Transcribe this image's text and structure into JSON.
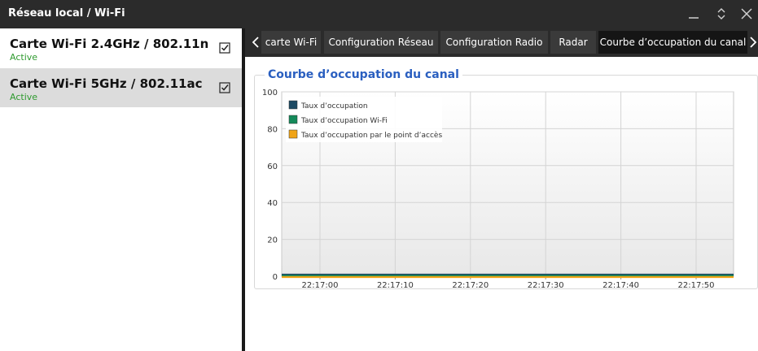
{
  "window": {
    "title": "Réseau local / Wi-Fi"
  },
  "sidebar": {
    "items": [
      {
        "name": "Carte Wi-Fi 2.4GHz / 802.11n",
        "status": "Active",
        "checked": true,
        "selected": false
      },
      {
        "name": "Carte Wi-Fi 5GHz / 802.11ac",
        "status": "Active",
        "checked": true,
        "selected": true
      }
    ]
  },
  "tabs": [
    {
      "label": "carte Wi-Fi"
    },
    {
      "label": "Configuration Réseau"
    },
    {
      "label": "Configuration Radio"
    },
    {
      "label": "Radar"
    },
    {
      "label": "Courbe d’occupation du canal",
      "active": true
    }
  ],
  "panel": {
    "title": "Courbe d’occupation du canal"
  },
  "colors": {
    "titlebar": "#2b2b2b",
    "accent_title": "#2a5fc0",
    "status_active": "#2e9a2e",
    "series_occupation": "#1d4a63",
    "series_wifi": "#148a5a",
    "series_ap": "#f0a417"
  },
  "chart_data": {
    "type": "line",
    "x": [
      "22:17:00",
      "22:17:10",
      "22:17:20",
      "22:17:30",
      "22:17:40",
      "22:17:50"
    ],
    "ylim": [
      0,
      100
    ],
    "yticks": [
      0,
      20,
      40,
      60,
      80,
      100
    ],
    "grid": true,
    "legend": "top-left",
    "series": [
      {
        "name": "Taux d’occupation",
        "values": [
          0,
          0,
          0,
          0,
          0,
          0
        ],
        "color": "#1d4a63"
      },
      {
        "name": "Taux d’occupation Wi-Fi",
        "values": [
          0,
          0,
          0,
          0,
          0,
          0
        ],
        "color": "#148a5a"
      },
      {
        "name": "Taux d’occupation par le point d’accès",
        "values": [
          0,
          0,
          0,
          0,
          0,
          0
        ],
        "color": "#f0a417"
      }
    ]
  }
}
